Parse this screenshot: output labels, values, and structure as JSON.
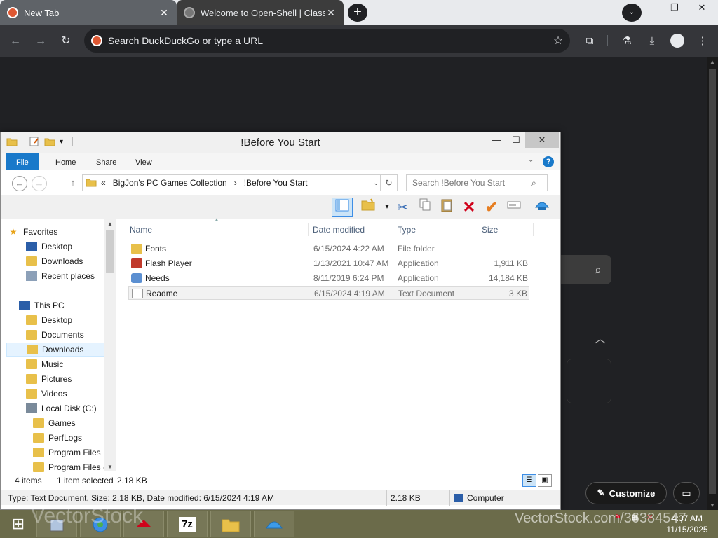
{
  "browser": {
    "tabs": [
      {
        "title": "New Tab",
        "close": "✕"
      },
      {
        "title": "Welcome to Open-Shell | Classic",
        "close": "✕"
      }
    ],
    "new_tab": "+",
    "tab_search": "⌄",
    "window_controls": {
      "minimize": "—",
      "restore": "❐",
      "close": "✕"
    },
    "nav": {
      "back": "←",
      "forward": "→",
      "reload": "↻"
    },
    "omnibox": {
      "placeholder": "Search DuckDuckGo or type a URL",
      "star": "☆"
    },
    "toolbar_icons": {
      "extensions": "⧉",
      "labs": "⚗",
      "download": "⤓",
      "menu": "⋮"
    }
  },
  "ntp": {
    "search_glyph": "⌕",
    "chevron": "︿",
    "customize_label": "Customize",
    "customize_glyph": "✎",
    "feedback_glyph": "▭"
  },
  "explorer": {
    "title": "!Before You Start",
    "qat": [
      "▾"
    ],
    "window_controls": {
      "minimize": "—",
      "maximize": "☐",
      "close": "✕"
    },
    "ribbon_tabs": [
      "File",
      "Home",
      "Share",
      "View"
    ],
    "ribbon_help": "?",
    "ribbon_expand": "⌄",
    "nav_buttons": {
      "back": "←",
      "forward": "→",
      "up": "↑"
    },
    "address": {
      "prefix": "«",
      "segments": [
        "BigJon's PC Games Collection",
        "!Before You Start"
      ],
      "separator": "›",
      "dropdown": "⌄",
      "refresh": "↻"
    },
    "search": {
      "placeholder": "Search !Before You Start",
      "glyph": "⌕"
    },
    "commands": [
      "layout",
      "new-folder",
      "cut",
      "copy",
      "paste",
      "delete",
      "rename",
      "properties",
      "shell"
    ],
    "nav_pane": {
      "favorites": {
        "label": "Favorites",
        "items": [
          "Desktop",
          "Downloads",
          "Recent places"
        ]
      },
      "this_pc": {
        "label": "This PC",
        "items": [
          "Desktop",
          "Documents",
          "Downloads",
          "Music",
          "Pictures",
          "Videos",
          "Local Disk (C:)"
        ]
      },
      "c_items": [
        "Games",
        "PerfLogs",
        "Program Files",
        "Program Files ("
      ],
      "selected": "Downloads"
    },
    "columns": {
      "name": "Name",
      "date": "Date modified",
      "type": "Type",
      "size": "Size"
    },
    "files": [
      {
        "name": "Fonts",
        "date": "6/15/2024 4:22 AM",
        "type": "File folder",
        "size": "",
        "icon": "folder-icon"
      },
      {
        "name": "Flash Player",
        "date": "1/13/2021 10:47 AM",
        "type": "Application",
        "size": "1,911 KB",
        "icon": "flash-player-icon"
      },
      {
        "name": "Needs",
        "date": "8/11/2019 6:24 PM",
        "type": "Application",
        "size": "14,184 KB",
        "icon": "setup-icon"
      },
      {
        "name": "Readme",
        "date": "6/15/2024 4:19 AM",
        "type": "Text Document",
        "size": "3 KB",
        "icon": "text-document-icon"
      }
    ],
    "status": {
      "count": "4 items",
      "selected": "1 item selected",
      "selected_size": "2.18 KB"
    },
    "details": {
      "info": "Type: Text Document, Size: 2.18 KB, Date modified: 6/15/2024 4:19 AM",
      "size": "2.18 KB",
      "location": "Computer"
    }
  },
  "taskbar": {
    "start": "⊞",
    "items": [
      "7z"
    ],
    "clock_time": "4:37 AM",
    "clock_date": "11/15/2025"
  },
  "watermark": {
    "text": "VectorStock.com/36384547",
    "text2": "VectorStock"
  }
}
